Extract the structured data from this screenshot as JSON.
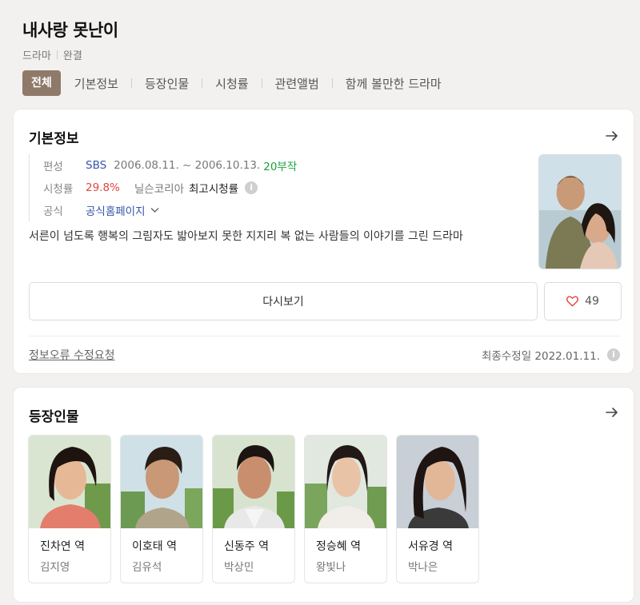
{
  "header": {
    "title": "내사랑 못난이",
    "genre": "드라마",
    "status": "완결",
    "tabs": [
      "전체",
      "기본정보",
      "등장인물",
      "시청률",
      "관련앨범",
      "함께 볼만한 드라마"
    ]
  },
  "basic_info": {
    "section_title": "기본정보",
    "network_label": "편성",
    "network": "SBS",
    "air_dates": "2006.08.11. ~ 2006.10.13.",
    "episodes": "20부작",
    "rating_label": "시청률",
    "rating": "29.8%",
    "rating_source": "닐슨코리아",
    "rating_type": "최고시청률",
    "official_label": "공식",
    "official_link": "공식홈페이지",
    "description": "서른이 넘도록 행복의 그림자도 밟아보지 못한 지지리 복 없는 사람들의 이야기를 그린 드라마",
    "rewatch_button": "다시보기",
    "like_count": "49",
    "report_link": "정보오류 수정요청",
    "last_updated": "최종수정일 2022.01.11."
  },
  "cast_section": {
    "section_title": "등장인물",
    "members": [
      {
        "role": "진차연 역",
        "actor": "김지영"
      },
      {
        "role": "이호태 역",
        "actor": "김유석"
      },
      {
        "role": "신동주 역",
        "actor": "박상민"
      },
      {
        "role": "정승혜 역",
        "actor": "왕빛나"
      },
      {
        "role": "서유경 역",
        "actor": "박나은"
      }
    ]
  },
  "icons": [
    "arrow-right-icon",
    "info-icon",
    "chevron-down-icon",
    "heart-icon"
  ],
  "colors": {
    "active_tab": "#8f7a6a",
    "link_blue": "#3455a8",
    "episodes_green": "#1aa33b",
    "rating_red": "#e0463f",
    "like_heart": "#e0463f"
  }
}
